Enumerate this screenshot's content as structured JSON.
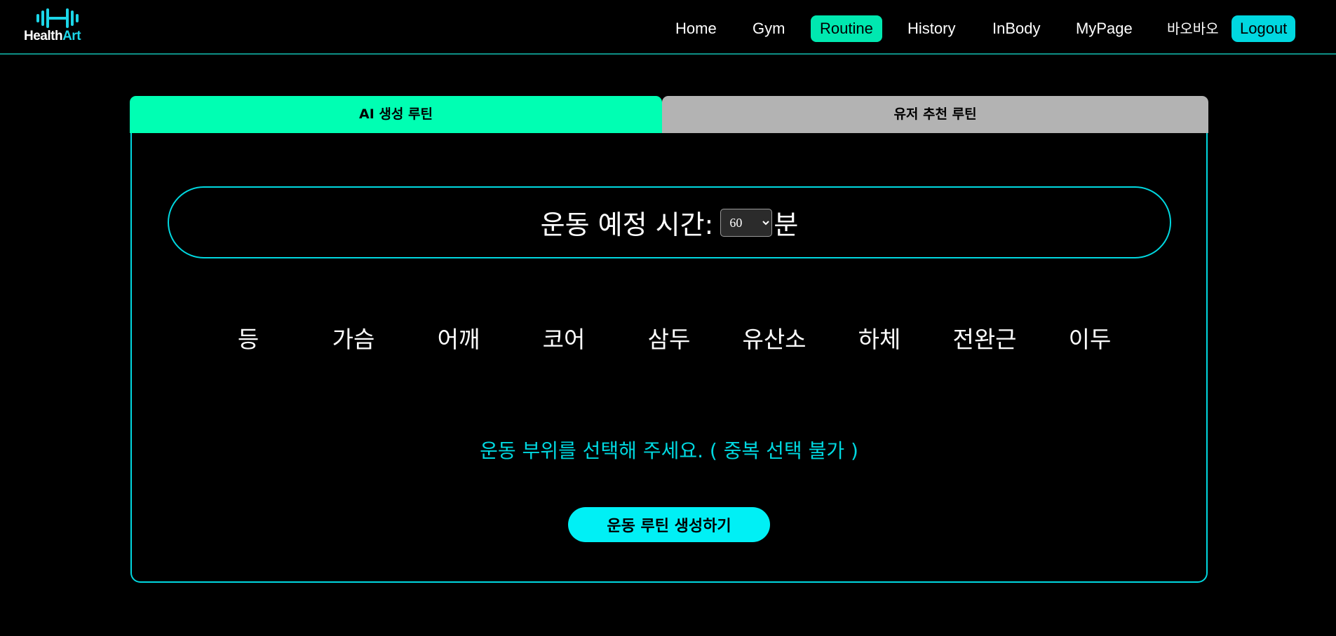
{
  "header": {
    "logo": {
      "text_main": "Health",
      "text_accent": "Art"
    },
    "nav": [
      {
        "label": "Home"
      },
      {
        "label": "Gym"
      },
      {
        "label": "Routine",
        "active": true
      },
      {
        "label": "History"
      },
      {
        "label": "InBody"
      },
      {
        "label": "MyPage"
      }
    ],
    "user_name": "바오바오",
    "logout_label": "Logout"
  },
  "tabs": [
    {
      "label": "AI 생성 루틴",
      "active": true
    },
    {
      "label": "유저 추천 루틴",
      "active": false
    }
  ],
  "time_select": {
    "label": "운동 예정 시간:",
    "value": "60",
    "unit": "분"
  },
  "body_parts": [
    "등",
    "가슴",
    "어깨",
    "코어",
    "삼두",
    "유산소",
    "하체",
    "전완근",
    "이두"
  ],
  "instruction": "운동 부위를 선택해 주세요. ( 중복 선택 불가 )",
  "generate_button": "운동 루틴 생성하기",
  "colors": {
    "accent_cyan": "#00d8e0",
    "accent_green": "#00ffb3",
    "inactive_tab": "#b3b3b3",
    "background": "#000000"
  }
}
